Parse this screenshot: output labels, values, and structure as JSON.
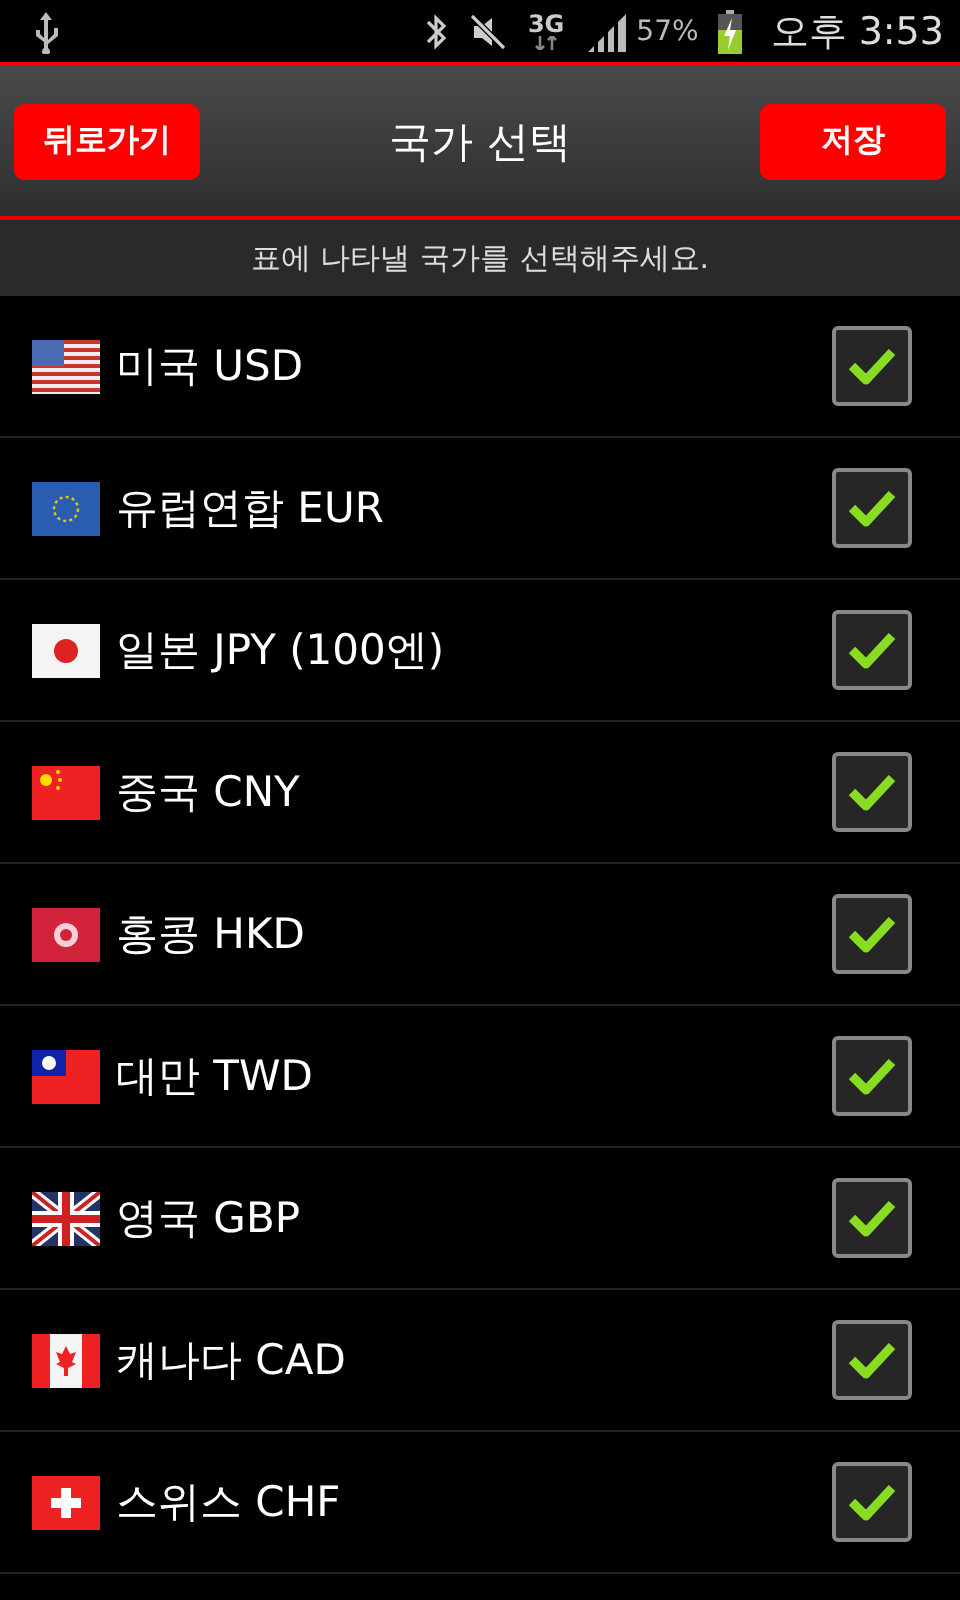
{
  "status_bar": {
    "network": "3G",
    "battery": "57%",
    "time": "오후 3:53"
  },
  "header": {
    "back_button": "뒤로가기",
    "title": "국가 선택",
    "save_button": "저장"
  },
  "instruction": "표에 나타낼 국가를 선택해주세요.",
  "countries": [
    {
      "label": "미국 USD",
      "checked": true
    },
    {
      "label": "유럽연합 EUR",
      "checked": true
    },
    {
      "label": "일본 JPY (100엔)",
      "checked": true
    },
    {
      "label": "중국 CNY",
      "checked": true
    },
    {
      "label": "홍콩 HKD",
      "checked": true
    },
    {
      "label": "대만 TWD",
      "checked": true
    },
    {
      "label": "영국 GBP",
      "checked": true
    },
    {
      "label": "캐나다 CAD",
      "checked": true
    },
    {
      "label": "스위스 CHF",
      "checked": true
    }
  ]
}
